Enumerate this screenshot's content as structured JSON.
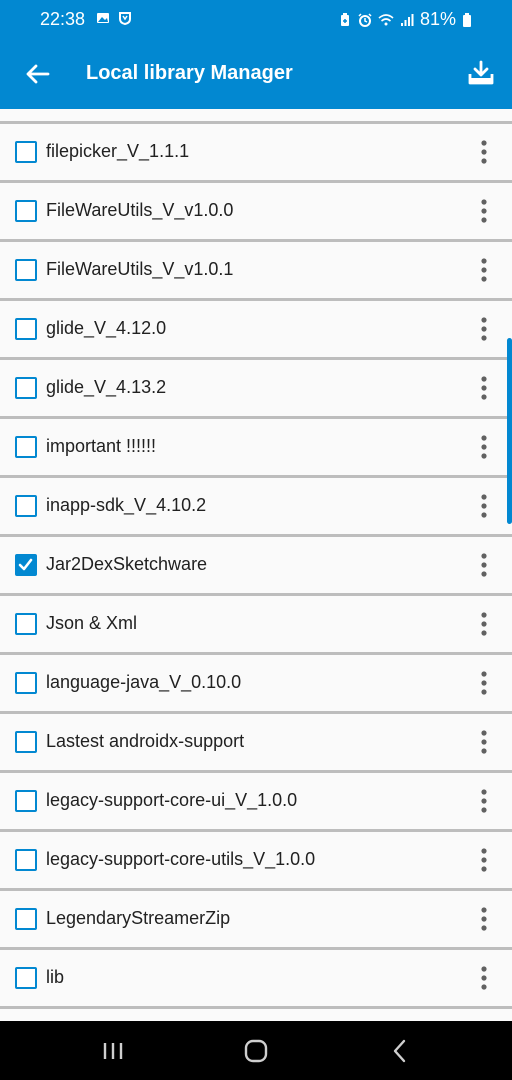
{
  "status_bar": {
    "time": "22:38",
    "battery": "81%",
    "icons": [
      "image-icon",
      "shield-icon",
      "battery-saver-icon",
      "alarm-icon",
      "wifi-icon",
      "signal-icon",
      "battery-icon"
    ]
  },
  "app_bar": {
    "title": "Local library Manager",
    "back_icon": "back-arrow-icon",
    "action_icon": "download-icon"
  },
  "colors": {
    "primary": "#0288d1",
    "divider": "#bdbdbd",
    "background": "#fafafa",
    "text": "#212121"
  },
  "libraries": [
    {
      "name": "filepicker_V_1.1.1",
      "checked": false
    },
    {
      "name": "FileWareUtils_V_v1.0.0",
      "checked": false
    },
    {
      "name": "FileWareUtils_V_v1.0.1",
      "checked": false
    },
    {
      "name": "glide_V_4.12.0",
      "checked": false
    },
    {
      "name": "glide_V_4.13.2",
      "checked": false
    },
    {
      "name": "important  !!!!!!",
      "checked": false
    },
    {
      "name": "inapp-sdk_V_4.10.2",
      "checked": false
    },
    {
      "name": "Jar2DexSketchware",
      "checked": true
    },
    {
      "name": "Json & Xml",
      "checked": false
    },
    {
      "name": "language-java_V_0.10.0",
      "checked": false
    },
    {
      "name": "Lastest androidx-support",
      "checked": false
    },
    {
      "name": "legacy-support-core-ui_V_1.0.0",
      "checked": false
    },
    {
      "name": "legacy-support-core-utils_V_1.0.0",
      "checked": false
    },
    {
      "name": "LegendaryStreamerZip",
      "checked": false
    },
    {
      "name": "lib",
      "checked": false
    }
  ],
  "nav_bar": {
    "icons": [
      "recents-icon",
      "home-icon",
      "back-icon"
    ]
  }
}
